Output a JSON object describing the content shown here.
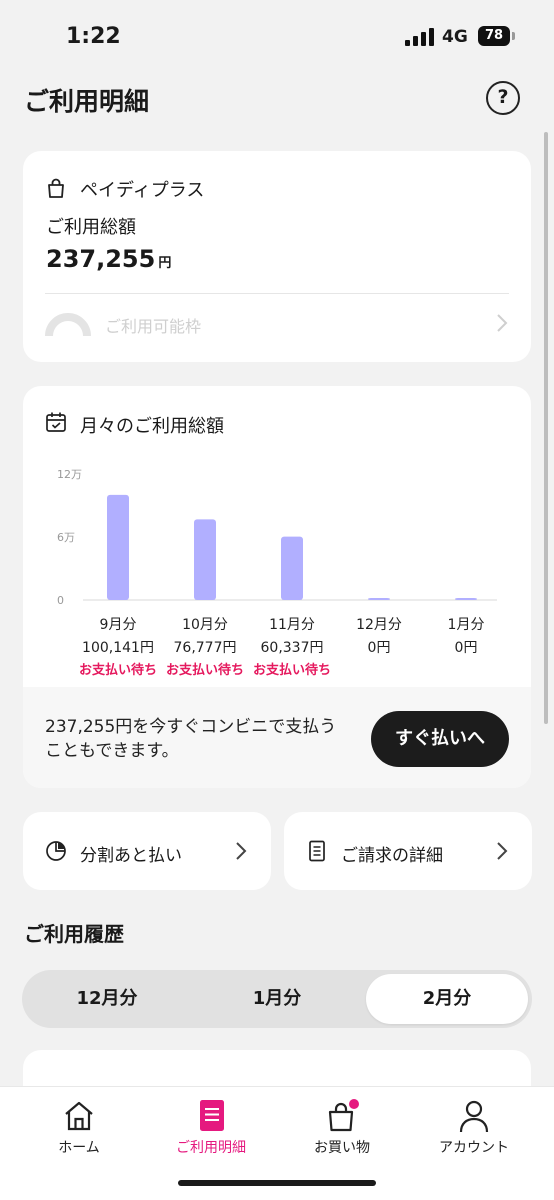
{
  "status_bar": {
    "time": "1:22",
    "network": "4G",
    "battery": "78"
  },
  "header": {
    "title": "ご利用明細",
    "help_label": "?"
  },
  "summary_card": {
    "brand": "ペイディプラス",
    "total_label": "ご利用総額",
    "total_amount": "237,255",
    "currency": "円",
    "limit_label": "ご利用可能枠"
  },
  "monthly_card": {
    "title": "月々のご利用総額",
    "message": "237,255円を今すぐコンビニで支払うこともできます。",
    "pay_button": "すぐ払いへ"
  },
  "chart_data": {
    "type": "bar",
    "categories": [
      "9月分",
      "10月分",
      "11月分",
      "12月分",
      "1月分"
    ],
    "values": [
      100141,
      76777,
      60337,
      0,
      0
    ],
    "value_labels": [
      "100,141円",
      "76,777円",
      "60,337円",
      "0円",
      "0円"
    ],
    "status_labels": [
      "お支払い待ち",
      "お支払い待ち",
      "お支払い待ち",
      "",
      ""
    ],
    "ylim": [
      0,
      120000
    ],
    "y_ticks": [
      0,
      60000,
      120000
    ],
    "y_tick_labels": [
      "0",
      "6万",
      "12万"
    ],
    "bar_color": "#b1afff",
    "status_color": "#e5195e"
  },
  "quick_links": [
    {
      "label": "分割あと払い",
      "icon": "pie-chart-icon"
    },
    {
      "label": "ご請求の詳細",
      "icon": "document-icon"
    }
  ],
  "history": {
    "title": "ご利用履歴",
    "tabs": [
      {
        "label": "12月分",
        "active": false
      },
      {
        "label": "1月分",
        "active": false
      },
      {
        "label": "2月分",
        "active": true
      }
    ]
  },
  "bottom_nav": [
    {
      "label": "ホーム",
      "icon": "home-icon",
      "active": false
    },
    {
      "label": "ご利用明細",
      "icon": "statement-icon",
      "active": true
    },
    {
      "label": "お買い物",
      "icon": "shopping-bag-icon",
      "active": false
    },
    {
      "label": "アカウント",
      "icon": "account-icon",
      "active": false
    }
  ],
  "colors": {
    "accent": "#e5197f",
    "dark": "#1c1c1c",
    "background": "#f2f2f2"
  }
}
